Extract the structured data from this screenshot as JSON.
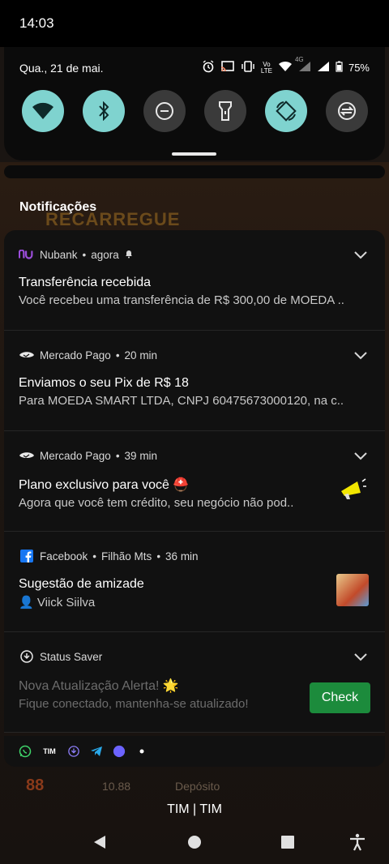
{
  "status": {
    "time": "14:03",
    "date": "Qua., 21 de mai.",
    "battery": "75%",
    "network_label": "4G",
    "volte_label": "LTE"
  },
  "quick_settings": [
    {
      "name": "wifi",
      "on": true
    },
    {
      "name": "bluetooth",
      "on": true
    },
    {
      "name": "do-not-disturb",
      "on": false
    },
    {
      "name": "flashlight",
      "on": false
    },
    {
      "name": "auto-rotate",
      "on": true
    },
    {
      "name": "data-saver",
      "on": false
    }
  ],
  "background_app": {
    "banner": "RECARREGUE",
    "balance": "10.88",
    "deposit": "Depósito",
    "ticket": "88"
  },
  "section": {
    "title": "Notificações"
  },
  "notifications": [
    {
      "app": "Nubank",
      "time": "agora",
      "title": "Transferência recebida",
      "body": "Você recebeu uma transferência de R$ 300,00 de MOEDA ..",
      "icon": "nubank-icon"
    },
    {
      "app": "Mercado Pago",
      "time": "20 min",
      "title": "Enviamos o seu Pix de R$ 18",
      "body": "Para MOEDA SMART LTDA, CNPJ 60475673000120, na c..",
      "icon": "mercado-pago-icon"
    },
    {
      "app": "Mercado Pago",
      "time": "39 min",
      "title": "Plano exclusivo para você ⛑️",
      "body": "Agora que você tem crédito, seu negócio não pod..",
      "icon": "mercado-pago-icon"
    },
    {
      "app": "Facebook",
      "sub": "Filhão Mts",
      "time": "36 min",
      "title": "Sugestão de amizade",
      "body": "👤 Viick Siilva",
      "icon": "facebook-icon"
    },
    {
      "app": "Status Saver",
      "title": "Nova Atualização Alerta! 🌟",
      "body": "Fique conectado, mantenha-se atualizado!",
      "action": "Check",
      "icon": "download-icon"
    }
  ],
  "overflow_icons": [
    "whatsapp-icon",
    "tim-icon",
    "download-icon",
    "telegram-icon",
    "circle-icon",
    "dot-icon"
  ],
  "overflow_labels": {
    "tim": "TIM"
  },
  "carrier": "TIM | TIM",
  "separator": "•"
}
